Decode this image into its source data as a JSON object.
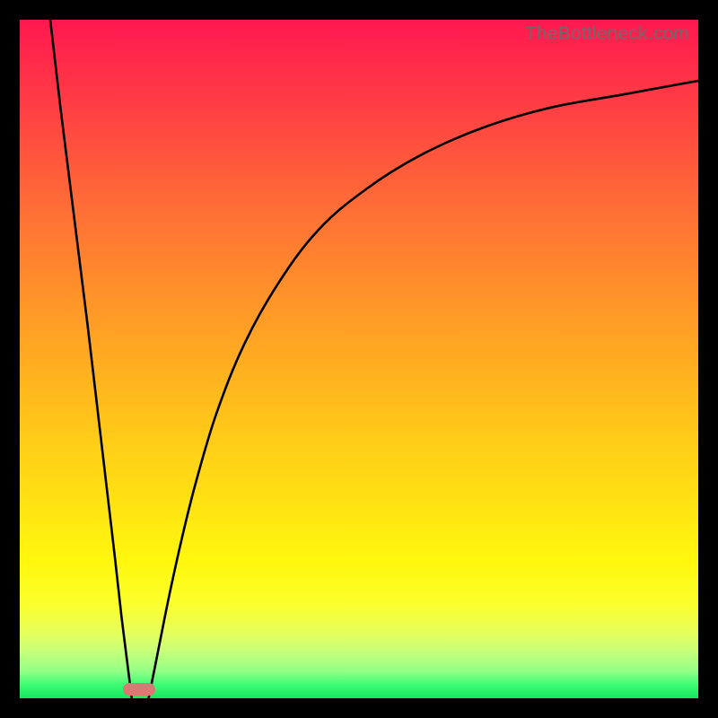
{
  "watermark": "TheBottleneck.com",
  "colors": {
    "frame": "#000000",
    "curve": "#000000",
    "marker_fill": "#d77a74"
  },
  "chart_data": {
    "type": "line",
    "title": "",
    "xlabel": "",
    "ylabel": "",
    "xlim": [
      0,
      100
    ],
    "ylim": [
      0,
      100
    ],
    "legend": false,
    "grid": false,
    "background_gradient_stops": [
      {
        "pos": 0,
        "color": "#ff1850"
      },
      {
        "pos": 14,
        "color": "#ff4243"
      },
      {
        "pos": 32,
        "color": "#ff7a32"
      },
      {
        "pos": 52,
        "color": "#ffb11f"
      },
      {
        "pos": 72,
        "color": "#ffe412"
      },
      {
        "pos": 86,
        "color": "#fbff2c"
      },
      {
        "pos": 96,
        "color": "#93ff86"
      },
      {
        "pos": 100,
        "color": "#15e860"
      }
    ],
    "series": [
      {
        "name": "left-branch",
        "x": [
          4.5,
          6,
          8,
          10,
          12,
          14,
          15,
          16,
          16.5
        ],
        "y": [
          100,
          87,
          71,
          55,
          38,
          21,
          12,
          4,
          0
        ]
      },
      {
        "name": "right-branch",
        "x": [
          19,
          20,
          22,
          24,
          26,
          29,
          33,
          38,
          44,
          51,
          59,
          68,
          78,
          89,
          100
        ],
        "y": [
          0,
          5,
          15,
          24,
          32,
          42,
          52,
          61,
          69,
          75,
          80,
          84,
          87,
          89,
          91
        ]
      }
    ],
    "marker": {
      "x": 17.6,
      "y": 1.3
    }
  }
}
